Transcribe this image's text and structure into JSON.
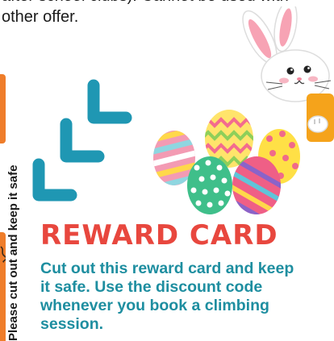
{
  "document": {
    "top_text_line1": "after school clubs). Cannot be used with",
    "top_text_line2": "other offer.",
    "side_text": "Please cut out and keep it safe",
    "reward_title": "REWARD CARD",
    "reward_body": "Cut out this reward card and keep it safe. Use the discount code whenever you book a climbing session."
  },
  "colors": {
    "accent_orange": "#ef7d2a",
    "title_red": "#e8473e",
    "body_teal": "#1e8ea0",
    "chevron_blue": "#1f97b3"
  },
  "illustrations": {
    "chevrons": "triple-chevron-arrow-icon",
    "eggs": "easter-eggs-illustration",
    "bunny": "peeking-bunny-illustration"
  }
}
